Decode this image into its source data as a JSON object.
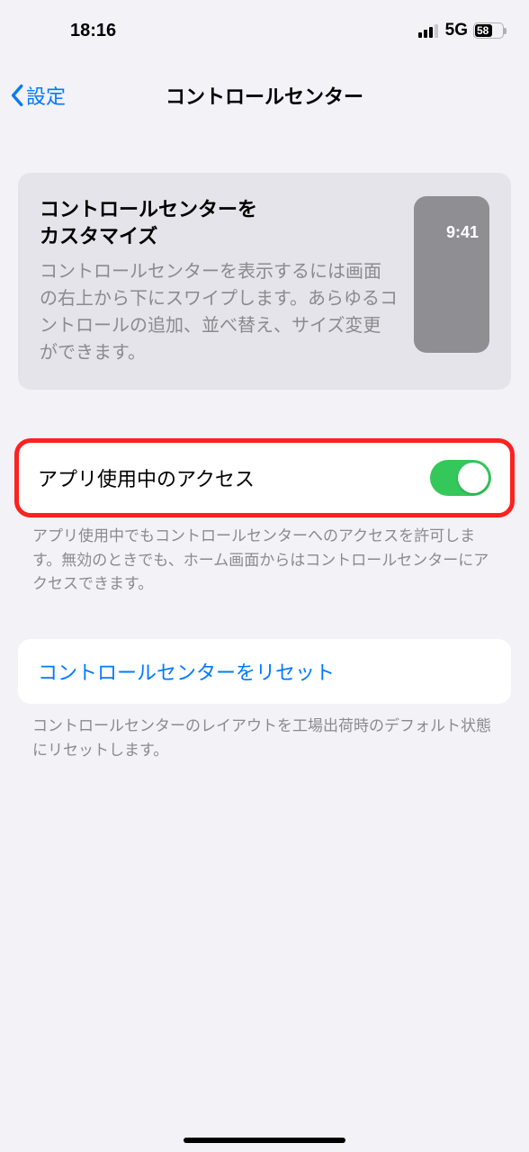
{
  "status": {
    "time": "18:16",
    "network": "5G",
    "battery_percent": "58"
  },
  "nav": {
    "back_label": "設定",
    "title": "コントロールセンター"
  },
  "info": {
    "title": "コントロールセンターを\nカスタマイズ",
    "desc": "コントロールセンターを表示するには画面の右上から下にスワイプします。あらゆるコントロールの追加、並べ替え、サイズ変更ができます。",
    "preview_time": "9:41"
  },
  "access": {
    "label": "アプリ使用中のアクセス",
    "on": true,
    "note": "アプリ使用中でもコントロールセンターへのアクセスを許可します。無効のときでも、ホーム画面からはコントロールセンターにアクセスできます。"
  },
  "reset": {
    "label": "コントロールセンターをリセット",
    "note": "コントロールセンターのレイアウトを工場出荷時のデフォルト状態にリセットします。"
  }
}
